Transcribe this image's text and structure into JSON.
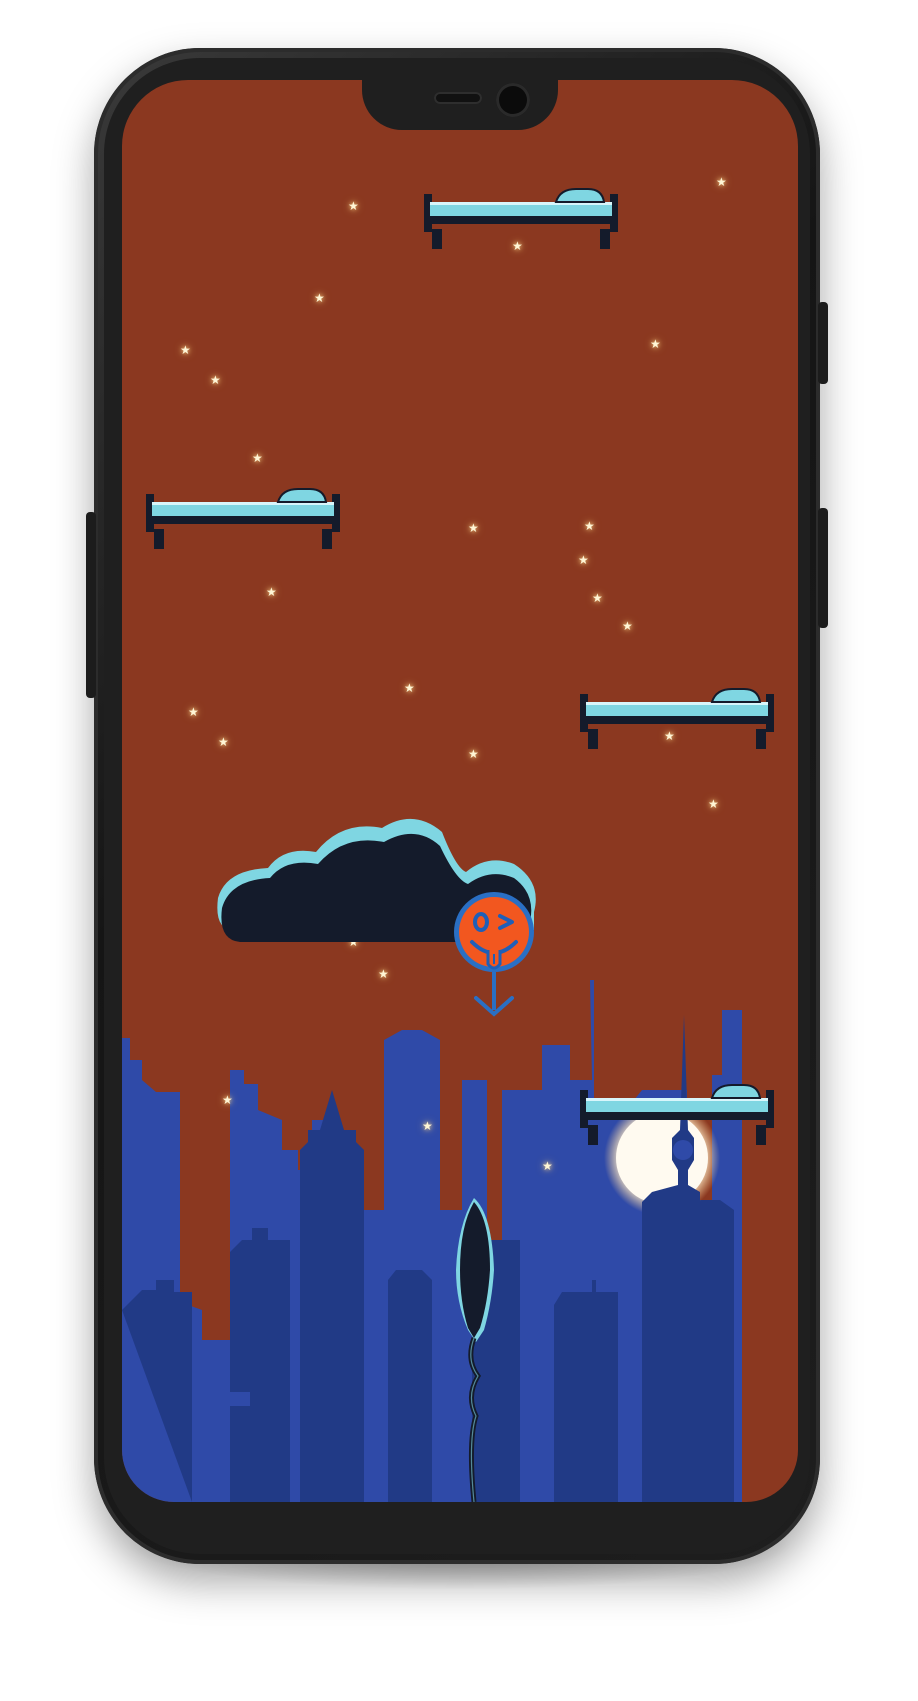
{
  "app": {
    "title": "",
    "device": "phone-mockup"
  },
  "colors": {
    "sky": "#8b3820",
    "city_light": "#2f4aa8",
    "city_dark": "#213a86",
    "bed_mattress": "#7fd6e2",
    "bed_frame": "#141b2b",
    "cloud_body": "#141b2b",
    "cloud_edge": "#7fd6e2",
    "player_face": "#f2571f",
    "player_outline": "#2a6fc4",
    "moon": "#fff8e6",
    "star": "#fff6d6",
    "phone_body": "#1f1f1f"
  },
  "scene": {
    "objects": [
      {
        "type": "bed-platform",
        "name": "top-bed"
      },
      {
        "type": "bed-platform",
        "name": "left-bed"
      },
      {
        "type": "bed-platform",
        "name": "right-bed"
      },
      {
        "type": "bed-platform",
        "name": "lower-right-bed"
      },
      {
        "type": "cloud",
        "name": "dark-cloud"
      },
      {
        "type": "player",
        "name": "winking-smiley-balloon",
        "expression": "wink, tongue out"
      },
      {
        "type": "enemy",
        "name": "dark-balloon-rocket"
      },
      {
        "type": "moon",
        "name": "rising-moon"
      },
      {
        "type": "background",
        "name": "city-skyline"
      }
    ],
    "star_icon": "star-icon",
    "star_count": 26
  },
  "hud": {
    "score": "",
    "visible": false
  }
}
